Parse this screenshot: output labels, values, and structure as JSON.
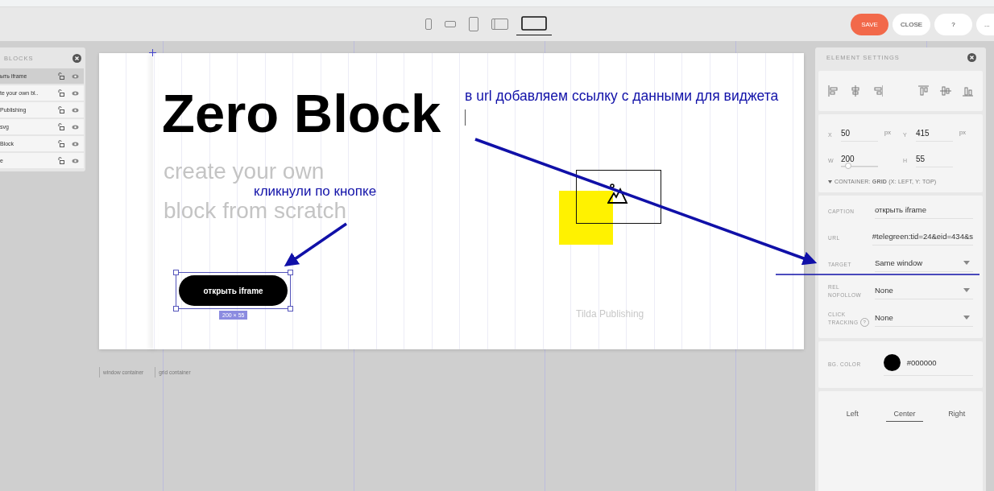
{
  "toolbar": {
    "devices": [
      {
        "kind": "phone",
        "selected": false
      },
      {
        "kind": "phone-landscape",
        "selected": false
      },
      {
        "kind": "tablet",
        "selected": false
      },
      {
        "kind": "tablet-landscape",
        "selected": false
      },
      {
        "kind": "laptop",
        "selected": true
      }
    ],
    "buttons": [
      {
        "label": "SAVE",
        "kind": "primary"
      },
      {
        "label": "CLOSE",
        "kind": "plain"
      },
      {
        "label": "?",
        "kind": "plain"
      },
      {
        "label": "...",
        "kind": "plain"
      }
    ]
  },
  "layers": {
    "title": "BLOCKS",
    "items": [
      {
        "label": "ыть iframe",
        "selected": true
      },
      {
        "label": "te your own bl..",
        "selected": false
      },
      {
        "label": "Publishing",
        "selected": false
      },
      {
        "label": "svg",
        "selected": false
      },
      {
        "label": "Block",
        "selected": false
      },
      {
        "label": "e",
        "selected": false
      }
    ]
  },
  "canvas": {
    "title": "Zero Block",
    "subtitle": [
      "create your own",
      "block from scratch"
    ],
    "button": {
      "label": "открыть iframe",
      "size": "200 × 55"
    },
    "footer_text": "Tilda Publishing",
    "container_labels": [
      "window container",
      "grid container"
    ]
  },
  "annotations": [
    {
      "text": "в url добавляем ссылку с данными для виджета",
      "kind": "url-note"
    },
    {
      "text": "кликнули по кнопке",
      "kind": "button-note"
    }
  ],
  "settings": {
    "title": "ELEMENT SETTINGS",
    "position": [
      {
        "label": "X",
        "value": "50",
        "unit": "px"
      },
      {
        "label": "Y",
        "value": "415",
        "unit": "px"
      },
      {
        "label": "W",
        "value": "200"
      },
      {
        "label": "H",
        "value": "55"
      }
    ],
    "width_slider": {
      "level": 0.2
    },
    "container": "CONTAINER: **GRID** (X: LEFT, Y: TOP)",
    "link_fields": [
      {
        "label": [
          "CAPTION"
        ],
        "value": "открыть iframe",
        "kind": "text"
      },
      {
        "label": [
          "URL"
        ],
        "value": "#telegreen:tid=24&eid=434&s",
        "kind": "text"
      },
      {
        "label": [
          "TARGET"
        ],
        "value": "Same window",
        "kind": "select"
      },
      {
        "label": [
          "REL",
          "NOFOLLOW"
        ],
        "value": "None",
        "kind": "select"
      },
      {
        "label": [
          "CLICK",
          "TRACKING"
        ],
        "value": "None",
        "kind": "select-help",
        "help": "?"
      }
    ],
    "bg_color": {
      "label": "BG. COLOR",
      "color": "#000000",
      "value": "#000000"
    },
    "align_tabs": [
      {
        "label": "Left",
        "selected": false
      },
      {
        "label": "Center",
        "selected": true
      },
      {
        "label": "Right",
        "selected": false
      }
    ]
  }
}
